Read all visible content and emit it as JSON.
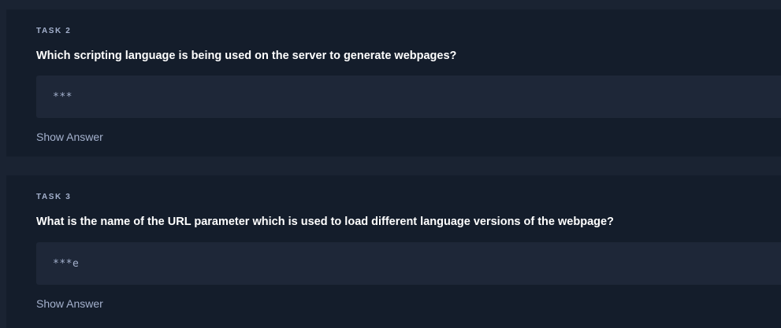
{
  "theme": {
    "page_background": "#1a2332",
    "card_background": "#141d2b",
    "answer_box_background": "#1e2738",
    "muted_text": "#a4b1cd",
    "question_text": "#ffffff"
  },
  "tasks": [
    {
      "label": "TASK 2",
      "question": "Which scripting language is being used on the server to generate webpages?",
      "answer_value": "***",
      "show_answer_label": "Show Answer"
    },
    {
      "label": "TASK 3",
      "question": "What is the name of the URL parameter which is used to load different language versions of the webpage?",
      "answer_value": "***e",
      "show_answer_label": "Show Answer"
    }
  ]
}
